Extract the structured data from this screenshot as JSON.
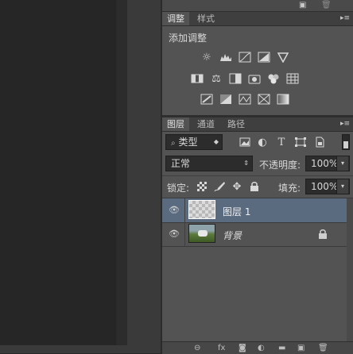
{
  "adjustments_panel": {
    "tabs": [
      {
        "label": "调整",
        "active": true
      },
      {
        "label": "样式",
        "active": false
      }
    ],
    "heading": "添加调整",
    "icons": [
      "brightness-contrast-icon",
      "levels-icon",
      "curves-icon",
      "exposure-icon",
      "vibrance-icon",
      "hue-saturation-icon",
      "color-balance-icon",
      "black-white-icon",
      "photo-filter-icon",
      "channel-mixer-icon",
      "color-lookup-icon",
      "invert-icon",
      "posterize-icon",
      "threshold-icon",
      "selective-color-icon",
      "gradient-map-icon"
    ]
  },
  "layers_panel": {
    "tabs": [
      {
        "label": "图层",
        "active": true
      },
      {
        "label": "通道",
        "active": false
      },
      {
        "label": "路径",
        "active": false
      }
    ],
    "filter": {
      "value": "类型"
    },
    "blend_mode": {
      "value": "正常"
    },
    "opacity": {
      "label": "不透明度:",
      "value": "100%"
    },
    "lock": {
      "label": "锁定:"
    },
    "fill": {
      "label": "填充:",
      "value": "100%"
    },
    "layers": [
      {
        "name": "图层 1",
        "selected": true,
        "visible": true,
        "locked": false
      },
      {
        "name": "背景",
        "selected": false,
        "visible": true,
        "locked": true
      }
    ]
  },
  "colors": {
    "panel_bg": "#535353",
    "selected_row": "#5a6b80",
    "tab_bar": "#3f3f3f",
    "canvas": "#262626"
  }
}
